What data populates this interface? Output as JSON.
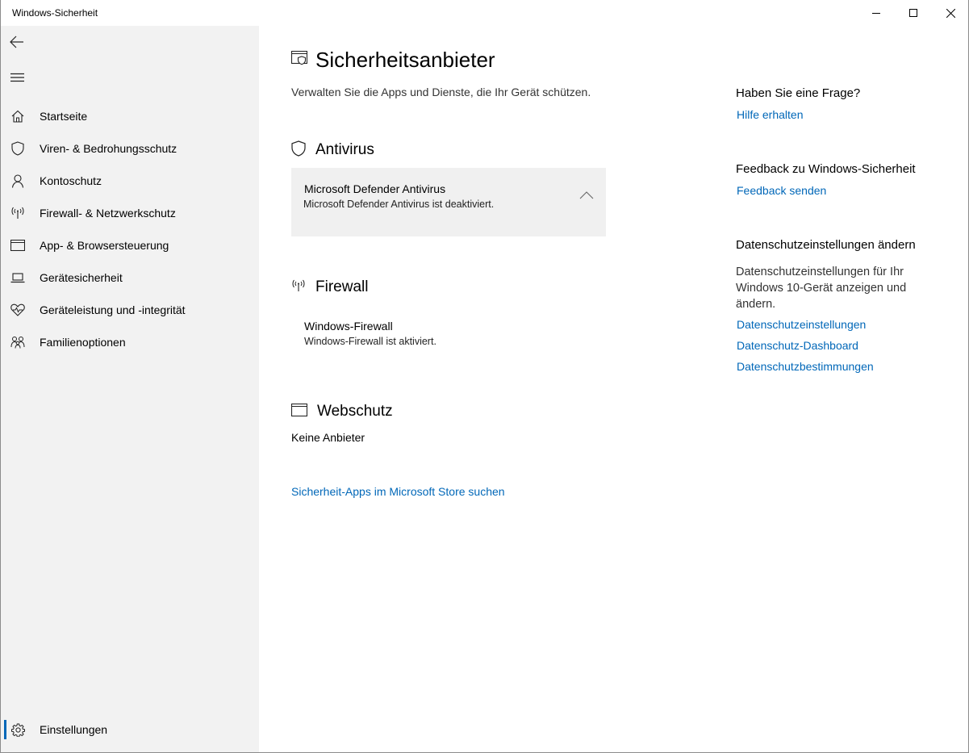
{
  "window": {
    "title": "Windows-Sicherheit"
  },
  "sidebar": {
    "items": [
      {
        "label": "Startseite",
        "icon": "home-icon"
      },
      {
        "label": "Viren- & Bedrohungsschutz",
        "icon": "shield-icon"
      },
      {
        "label": "Kontoschutz",
        "icon": "person-icon"
      },
      {
        "label": "Firewall- & Netzwerkschutz",
        "icon": "antenna-icon"
      },
      {
        "label": "App- & Browsersteuerung",
        "icon": "browser-window-icon"
      },
      {
        "label": "Gerätesicherheit",
        "icon": "laptop-icon"
      },
      {
        "label": "Geräteleistung und -integrität",
        "icon": "heart-icon"
      },
      {
        "label": "Familienoptionen",
        "icon": "family-icon"
      }
    ],
    "settings": {
      "label": "Einstellungen",
      "icon": "gear-icon",
      "selected": true
    }
  },
  "main": {
    "title": "Sicherheitsanbieter",
    "subtitle": "Verwalten Sie die Apps und Dienste, die Ihr Gerät schützen.",
    "antivirus": {
      "heading": "Antivirus",
      "provider": "Microsoft Defender Antivirus",
      "status": "Microsoft Defender Antivirus ist deaktiviert.",
      "expanded": true
    },
    "firewall": {
      "heading": "Firewall",
      "provider": "Windows-Firewall",
      "status": "Windows-Firewall ist aktiviert."
    },
    "webprotection": {
      "heading": "Webschutz",
      "status": "Keine Anbieter"
    },
    "store_link": "Sicherheit-Apps im Microsoft Store suchen"
  },
  "aside": {
    "question_heading": "Haben Sie eine Frage?",
    "help_link": "Hilfe erhalten",
    "feedback_heading": "Feedback zu Windows-Sicherheit",
    "feedback_link": "Feedback senden",
    "privacy_heading": "Datenschutzeinstellungen ändern",
    "privacy_text": "Datenschutzeinstellungen für Ihr Windows 10-Gerät anzeigen und ändern.",
    "privacy_links": [
      "Datenschutzeinstellungen",
      "Datenschutz-Dashboard",
      "Datenschutzbestimmungen"
    ]
  },
  "colors": {
    "accent": "#0067b8",
    "sidebar_bg": "#f2f2f2",
    "card_bg": "#f0f0f0"
  }
}
